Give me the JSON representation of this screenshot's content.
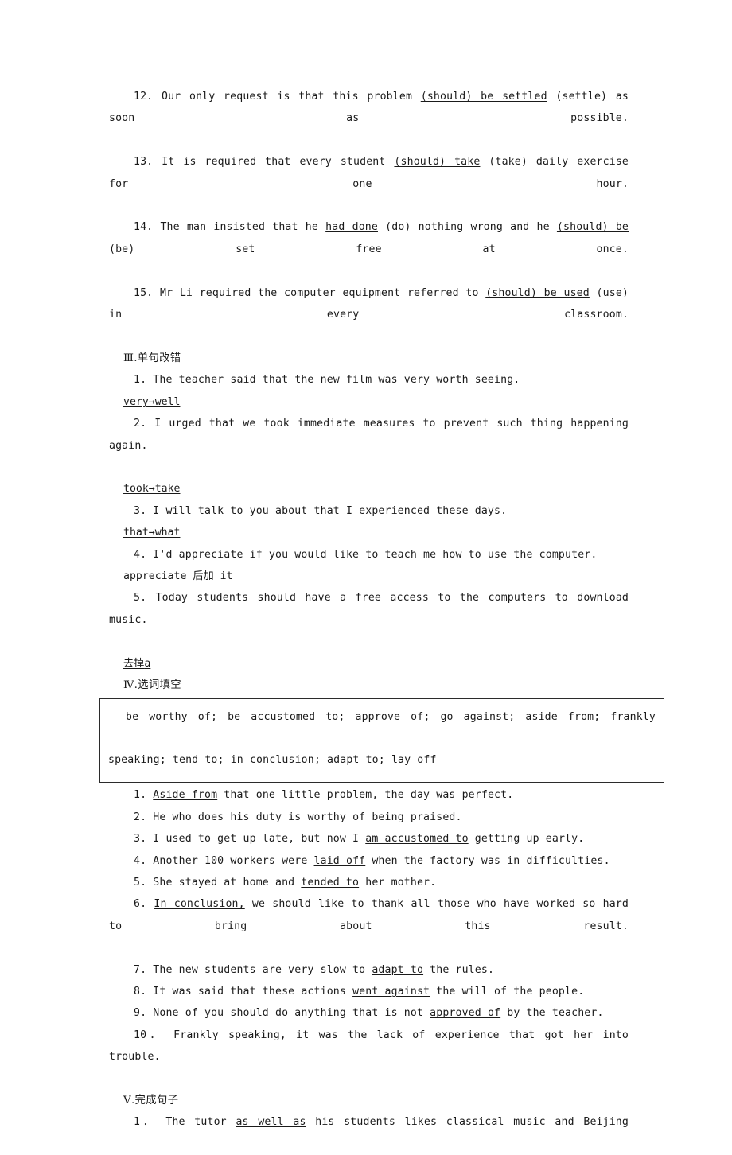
{
  "document": {
    "type": "english-grammar-workbook-answer-key",
    "language": "en-zh"
  },
  "section_ii_continued": {
    "items": [
      {
        "number": "12.",
        "pre": "Our only request is that this problem ",
        "answer": "(should) be settled",
        "post": " (settle) as soon as possible."
      },
      {
        "number": "13.",
        "pre": "It is required that every student ",
        "answer": "(should) take",
        "post": " (take) daily exercise for one hour."
      },
      {
        "number": "14.",
        "pre": "The man insisted that he ",
        "answer": "had done",
        "mid": " (do) nothing wrong and he ",
        "answer2": "(should) be",
        "post": " (be) set free at once."
      },
      {
        "number": "15.",
        "pre": "Mr Li required the computer equipment referred to ",
        "answer": "(should) be used",
        "post": " (use) in every classroom."
      }
    ]
  },
  "section_iii": {
    "roman": "Ⅲ.",
    "title": "单句改错",
    "items": [
      {
        "number": "1.",
        "sentence": "The teacher said that the new film was very worth seeing.",
        "correction": "very→well"
      },
      {
        "number": "2.",
        "sentence": "I urged that we took immediate measures to prevent such thing happening again.",
        "correction": "took→take"
      },
      {
        "number": "3.",
        "sentence": "I will talk to you about that I experienced these days.",
        "correction": "that→what"
      },
      {
        "number": "4.",
        "sentence": "I'd appreciate if you would like to teach me how to use the computer.",
        "correction_pre": "appreciate ",
        "correction_cjk": "后加",
        "correction_post": " it"
      },
      {
        "number": "5.",
        "sentence": "Today students should have a free access to the computers to download music.",
        "correction_cjk": "去掉",
        "correction_post": "a"
      }
    ]
  },
  "section_iv": {
    "roman": "Ⅳ.",
    "title": "选词填空",
    "word_bank_line1": "be worthy of;  be accustomed to;  approve of;  go against;  aside from;  frankly",
    "word_bank_line2": "speaking;  tend to;  in conclusion;  adapt to;  lay off",
    "word_bank": [
      "be worthy of",
      "be accustomed to",
      "approve of",
      "go against",
      "aside from",
      "frankly speaking",
      "tend to",
      "in conclusion",
      "adapt to",
      "lay off"
    ],
    "items": [
      {
        "number": "1.",
        "pre": "",
        "answer": "Aside from",
        "post": " that one little problem, the day was perfect."
      },
      {
        "number": "2.",
        "pre": "He who does his duty ",
        "answer": "is worthy of",
        "post": " being praised."
      },
      {
        "number": "3.",
        "pre": "I used to get up late, but now I ",
        "answer": "am accustomed to",
        "post": " getting up early."
      },
      {
        "number": "4.",
        "pre": "Another 100 workers were ",
        "answer": "laid off",
        "post": " when the factory was in difficulties."
      },
      {
        "number": "5.",
        "pre": "She stayed at home and ",
        "answer": "tended to",
        "post": " her mother."
      },
      {
        "number": "6.",
        "pre": "",
        "answer": "In conclusion,",
        "post": " we should like to thank all those who have worked so hard to bring about this result."
      },
      {
        "number": "7.",
        "pre": "The new students are very slow to ",
        "answer": "adapt to",
        "post": " the rules."
      },
      {
        "number": "8.",
        "pre": "It was said that these actions ",
        "answer": "went against",
        "post": " the will of the people."
      },
      {
        "number": "9.",
        "pre": "None of you should do anything that is not ",
        "answer": "approved of",
        "post": " by the teacher."
      },
      {
        "number": "10．",
        "pre": "",
        "answer": "Frankly speaking,",
        "post": " it was the lack of experience that got her into trouble."
      }
    ]
  },
  "section_v": {
    "roman": "Ⅴ.",
    "title": "完成句子",
    "items": [
      {
        "number": "1．",
        "pre": "The tutor ",
        "answer": "as well as",
        "post": " his students likes classical music and Beijing"
      }
    ]
  }
}
